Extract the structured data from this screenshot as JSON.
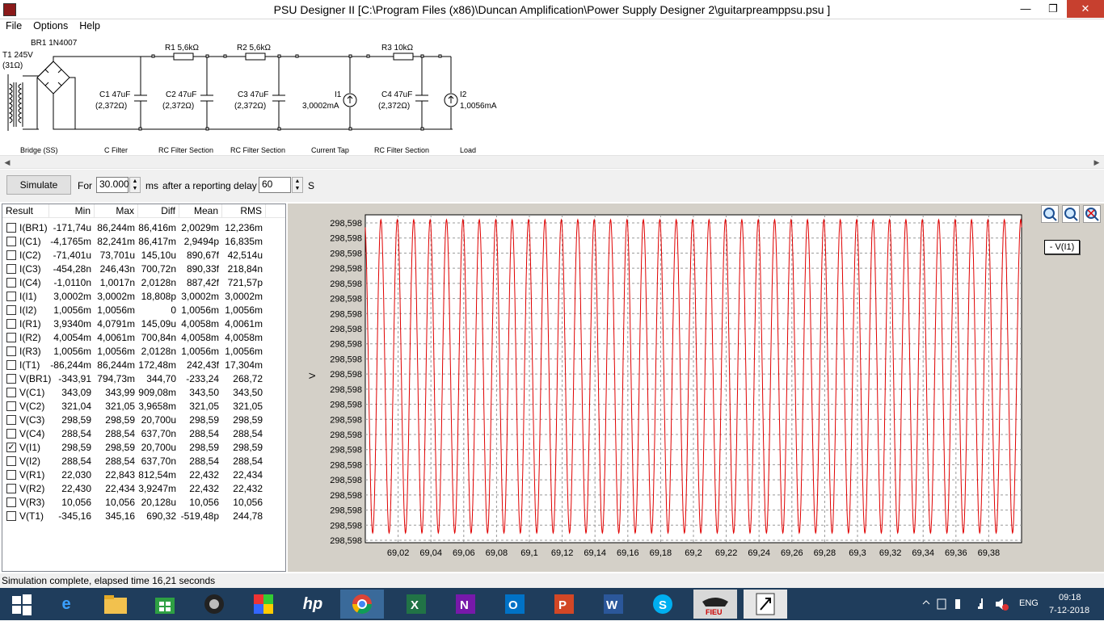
{
  "window": {
    "title": "PSU Designer II  [C:\\Program Files (x86)\\Duncan Amplification\\Power Supply Designer 2\\guitarpreamppsu.psu ]"
  },
  "menu": [
    "File",
    "Options",
    "Help"
  ],
  "circuit": {
    "transformer": {
      "name": "T1 245V",
      "res": "(31Ω)"
    },
    "bridge": {
      "name": "BR1 1N4007"
    },
    "resistors": [
      {
        "name": "R1 5,6kΩ"
      },
      {
        "name": "R2 5,6kΩ"
      },
      {
        "name": "R3 10kΩ"
      }
    ],
    "components": [
      {
        "name": "C1 47uF",
        "value": "(2,372Ω)"
      },
      {
        "name": "C2 47uF",
        "value": "(2,372Ω)"
      },
      {
        "name": "C3 47uF",
        "value": "(2,372Ω)"
      },
      {
        "name": "I1",
        "value": "3,0002mA"
      },
      {
        "name": "C4 47uF",
        "value": "(2,372Ω)"
      },
      {
        "name": "I2",
        "value": "1,0056mA"
      }
    ],
    "sections": [
      "Bridge (SS)",
      "C Filter",
      "RC Filter Section",
      "RC Filter Section",
      "Current Tap",
      "RC Filter Section",
      "Load"
    ]
  },
  "toolbar": {
    "simulate": "Simulate",
    "for_label": "For",
    "duration": "30.000",
    "ms_label": "ms",
    "delay_label": "after a reporting delay of",
    "delay": "60",
    "s_label": "S"
  },
  "results": {
    "headers": [
      "Result",
      "Min",
      "Max",
      "Diff",
      "Mean",
      "RMS"
    ],
    "rows": [
      {
        "name": "I(BR1)",
        "checked": false,
        "min": "-171,74u",
        "max": "86,244m",
        "diff": "86,416m",
        "mean": "2,0029m",
        "rms": "12,236m"
      },
      {
        "name": "I(C1)",
        "checked": false,
        "min": "-4,1765m",
        "max": "82,241m",
        "diff": "86,417m",
        "mean": "2,9494p",
        "rms": "16,835m"
      },
      {
        "name": "I(C2)",
        "checked": false,
        "min": "-71,401u",
        "max": "73,701u",
        "diff": "145,10u",
        "mean": "890,67f",
        "rms": "42,514u"
      },
      {
        "name": "I(C3)",
        "checked": false,
        "min": "-454,28n",
        "max": "246,43n",
        "diff": "700,72n",
        "mean": "890,33f",
        "rms": "218,84n"
      },
      {
        "name": "I(C4)",
        "checked": false,
        "min": "-1,0110n",
        "max": "1,0017n",
        "diff": "2,0128n",
        "mean": "887,42f",
        "rms": "721,57p"
      },
      {
        "name": "I(I1)",
        "checked": false,
        "min": "3,0002m",
        "max": "3,0002m",
        "diff": "18,808p",
        "mean": "3,0002m",
        "rms": "3,0002m"
      },
      {
        "name": "I(I2)",
        "checked": false,
        "min": "1,0056m",
        "max": "1,0056m",
        "diff": "0",
        "mean": "1,0056m",
        "rms": "1,0056m"
      },
      {
        "name": "I(R1)",
        "checked": false,
        "min": "3,9340m",
        "max": "4,0791m",
        "diff": "145,09u",
        "mean": "4,0058m",
        "rms": "4,0061m"
      },
      {
        "name": "I(R2)",
        "checked": false,
        "min": "4,0054m",
        "max": "4,0061m",
        "diff": "700,84n",
        "mean": "4,0058m",
        "rms": "4,0058m"
      },
      {
        "name": "I(R3)",
        "checked": false,
        "min": "1,0056m",
        "max": "1,0056m",
        "diff": "2,0128n",
        "mean": "1,0056m",
        "rms": "1,0056m"
      },
      {
        "name": "I(T1)",
        "checked": false,
        "min": "-86,244m",
        "max": "86,244m",
        "diff": "172,48m",
        "mean": "242,43f",
        "rms": "17,304m"
      },
      {
        "name": "V(BR1)",
        "checked": false,
        "min": "-343,91",
        "max": "794,73m",
        "diff": "344,70",
        "mean": "-233,24",
        "rms": "268,72"
      },
      {
        "name": "V(C1)",
        "checked": false,
        "min": "343,09",
        "max": "343,99",
        "diff": "909,08m",
        "mean": "343,50",
        "rms": "343,50"
      },
      {
        "name": "V(C2)",
        "checked": false,
        "min": "321,04",
        "max": "321,05",
        "diff": "3,9658m",
        "mean": "321,05",
        "rms": "321,05"
      },
      {
        "name": "V(C3)",
        "checked": false,
        "min": "298,59",
        "max": "298,59",
        "diff": "20,700u",
        "mean": "298,59",
        "rms": "298,59"
      },
      {
        "name": "V(C4)",
        "checked": false,
        "min": "288,54",
        "max": "288,54",
        "diff": "637,70n",
        "mean": "288,54",
        "rms": "288,54"
      },
      {
        "name": "V(I1)",
        "checked": true,
        "min": "298,59",
        "max": "298,59",
        "diff": "20,700u",
        "mean": "298,59",
        "rms": "298,59"
      },
      {
        "name": "V(I2)",
        "checked": false,
        "min": "288,54",
        "max": "288,54",
        "diff": "637,70n",
        "mean": "288,54",
        "rms": "288,54"
      },
      {
        "name": "V(R1)",
        "checked": false,
        "min": "22,030",
        "max": "22,843",
        "diff": "812,54m",
        "mean": "22,432",
        "rms": "22,434"
      },
      {
        "name": "V(R2)",
        "checked": false,
        "min": "22,430",
        "max": "22,434",
        "diff": "3,9247m",
        "mean": "22,432",
        "rms": "22,432"
      },
      {
        "name": "V(R3)",
        "checked": false,
        "min": "10,056",
        "max": "10,056",
        "diff": "20,128u",
        "mean": "10,056",
        "rms": "10,056"
      },
      {
        "name": "V(T1)",
        "checked": false,
        "min": "-345,16",
        "max": "345,16",
        "diff": "690,32",
        "mean": "-519,48p",
        "rms": "244,78"
      }
    ]
  },
  "chart_data": {
    "type": "line",
    "ylabel": "V",
    "xlabel": "",
    "y_tick_labels": [
      "298,598",
      "298,598",
      "298,598",
      "298,598",
      "298,598",
      "298,598",
      "298,598",
      "298,598",
      "298,598",
      "298,598",
      "298,598",
      "298,598",
      "298,598",
      "298,598",
      "298,598",
      "298,598",
      "298,598",
      "298,598",
      "298,598",
      "298,598",
      "298,598",
      "298,598"
    ],
    "x_tick_labels": [
      "69,02",
      "69,04",
      "69,06",
      "69,08",
      "69,1",
      "69,12",
      "69,14",
      "69,16",
      "69,18",
      "69,2",
      "69,22",
      "69,24",
      "69,26",
      "69,28",
      "69,3",
      "69,32",
      "69,34",
      "69,36",
      "69,38"
    ],
    "xlim": [
      69.0,
      69.4
    ],
    "series": [
      {
        "name": "V(I1)",
        "color": "#e00000",
        "period": 0.01,
        "description_of_shape": "ripple"
      }
    ],
    "grid": true,
    "legend": "top-right"
  },
  "status": "Simulation complete, elapsed time 16,21 seconds",
  "taskbar": {
    "apps": [
      "windows-start",
      "internet-explorer",
      "file-explorer",
      "store",
      "webcam",
      "paint",
      "hp",
      "chrome",
      "excel",
      "onenote",
      "outlook",
      "powerpoint",
      "word",
      "skype",
      "fiesta",
      "psu-designer"
    ],
    "lang": "ENG",
    "time": "09:18",
    "date": "7-12-2018"
  }
}
